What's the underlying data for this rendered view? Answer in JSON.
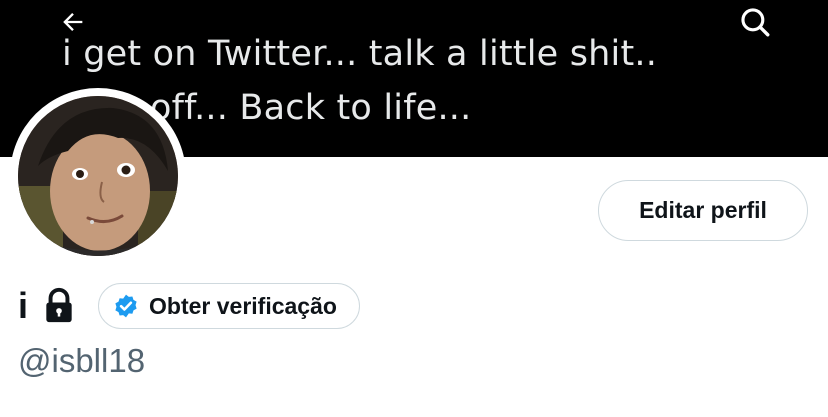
{
  "banner": {
    "line1": "i get on Twitter... talk a little shit..",
    "line2": "off... Back to life..."
  },
  "nav": {
    "back_icon": "arrow-left-icon",
    "search_icon": "search-icon"
  },
  "profile": {
    "edit_label": "Editar perfil",
    "name": "i",
    "lock_icon": "lock-icon",
    "verify_label": "Obter verificação",
    "verify_icon": "verified-badge-icon",
    "handle": "@isbll18"
  },
  "colors": {
    "banner_bg": "#000000",
    "text_primary": "#0f1419",
    "text_secondary": "#536471",
    "border": "#cfd9de",
    "verified_blue": "#1d9bf0"
  }
}
